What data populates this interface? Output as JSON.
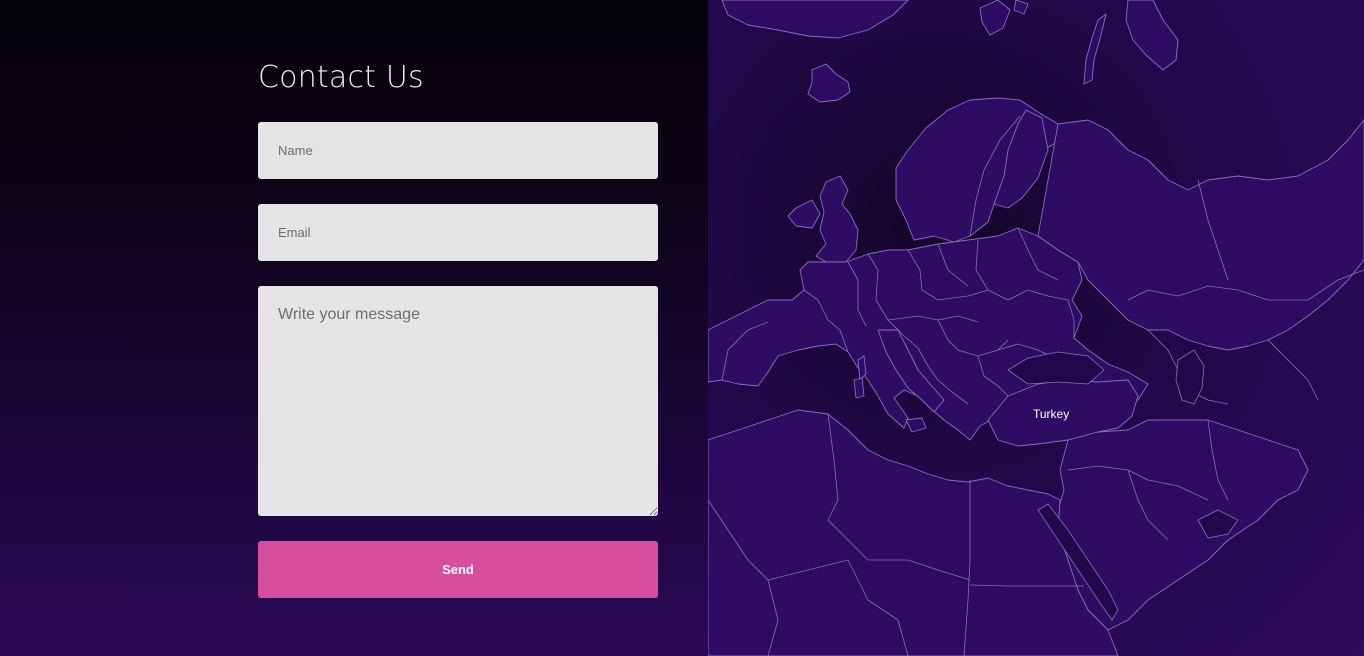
{
  "contact": {
    "title": "Contact Us",
    "name_placeholder": "Name",
    "email_placeholder": "Email",
    "message_placeholder": "Write your message",
    "send_label": "Send"
  },
  "map": {
    "highlight_label": "Turkey"
  },
  "colors": {
    "send_button": "#d94d9f",
    "field_background": "#e6e4e7",
    "map_land": "#2e0c63",
    "map_border": "#8b6cc0"
  }
}
